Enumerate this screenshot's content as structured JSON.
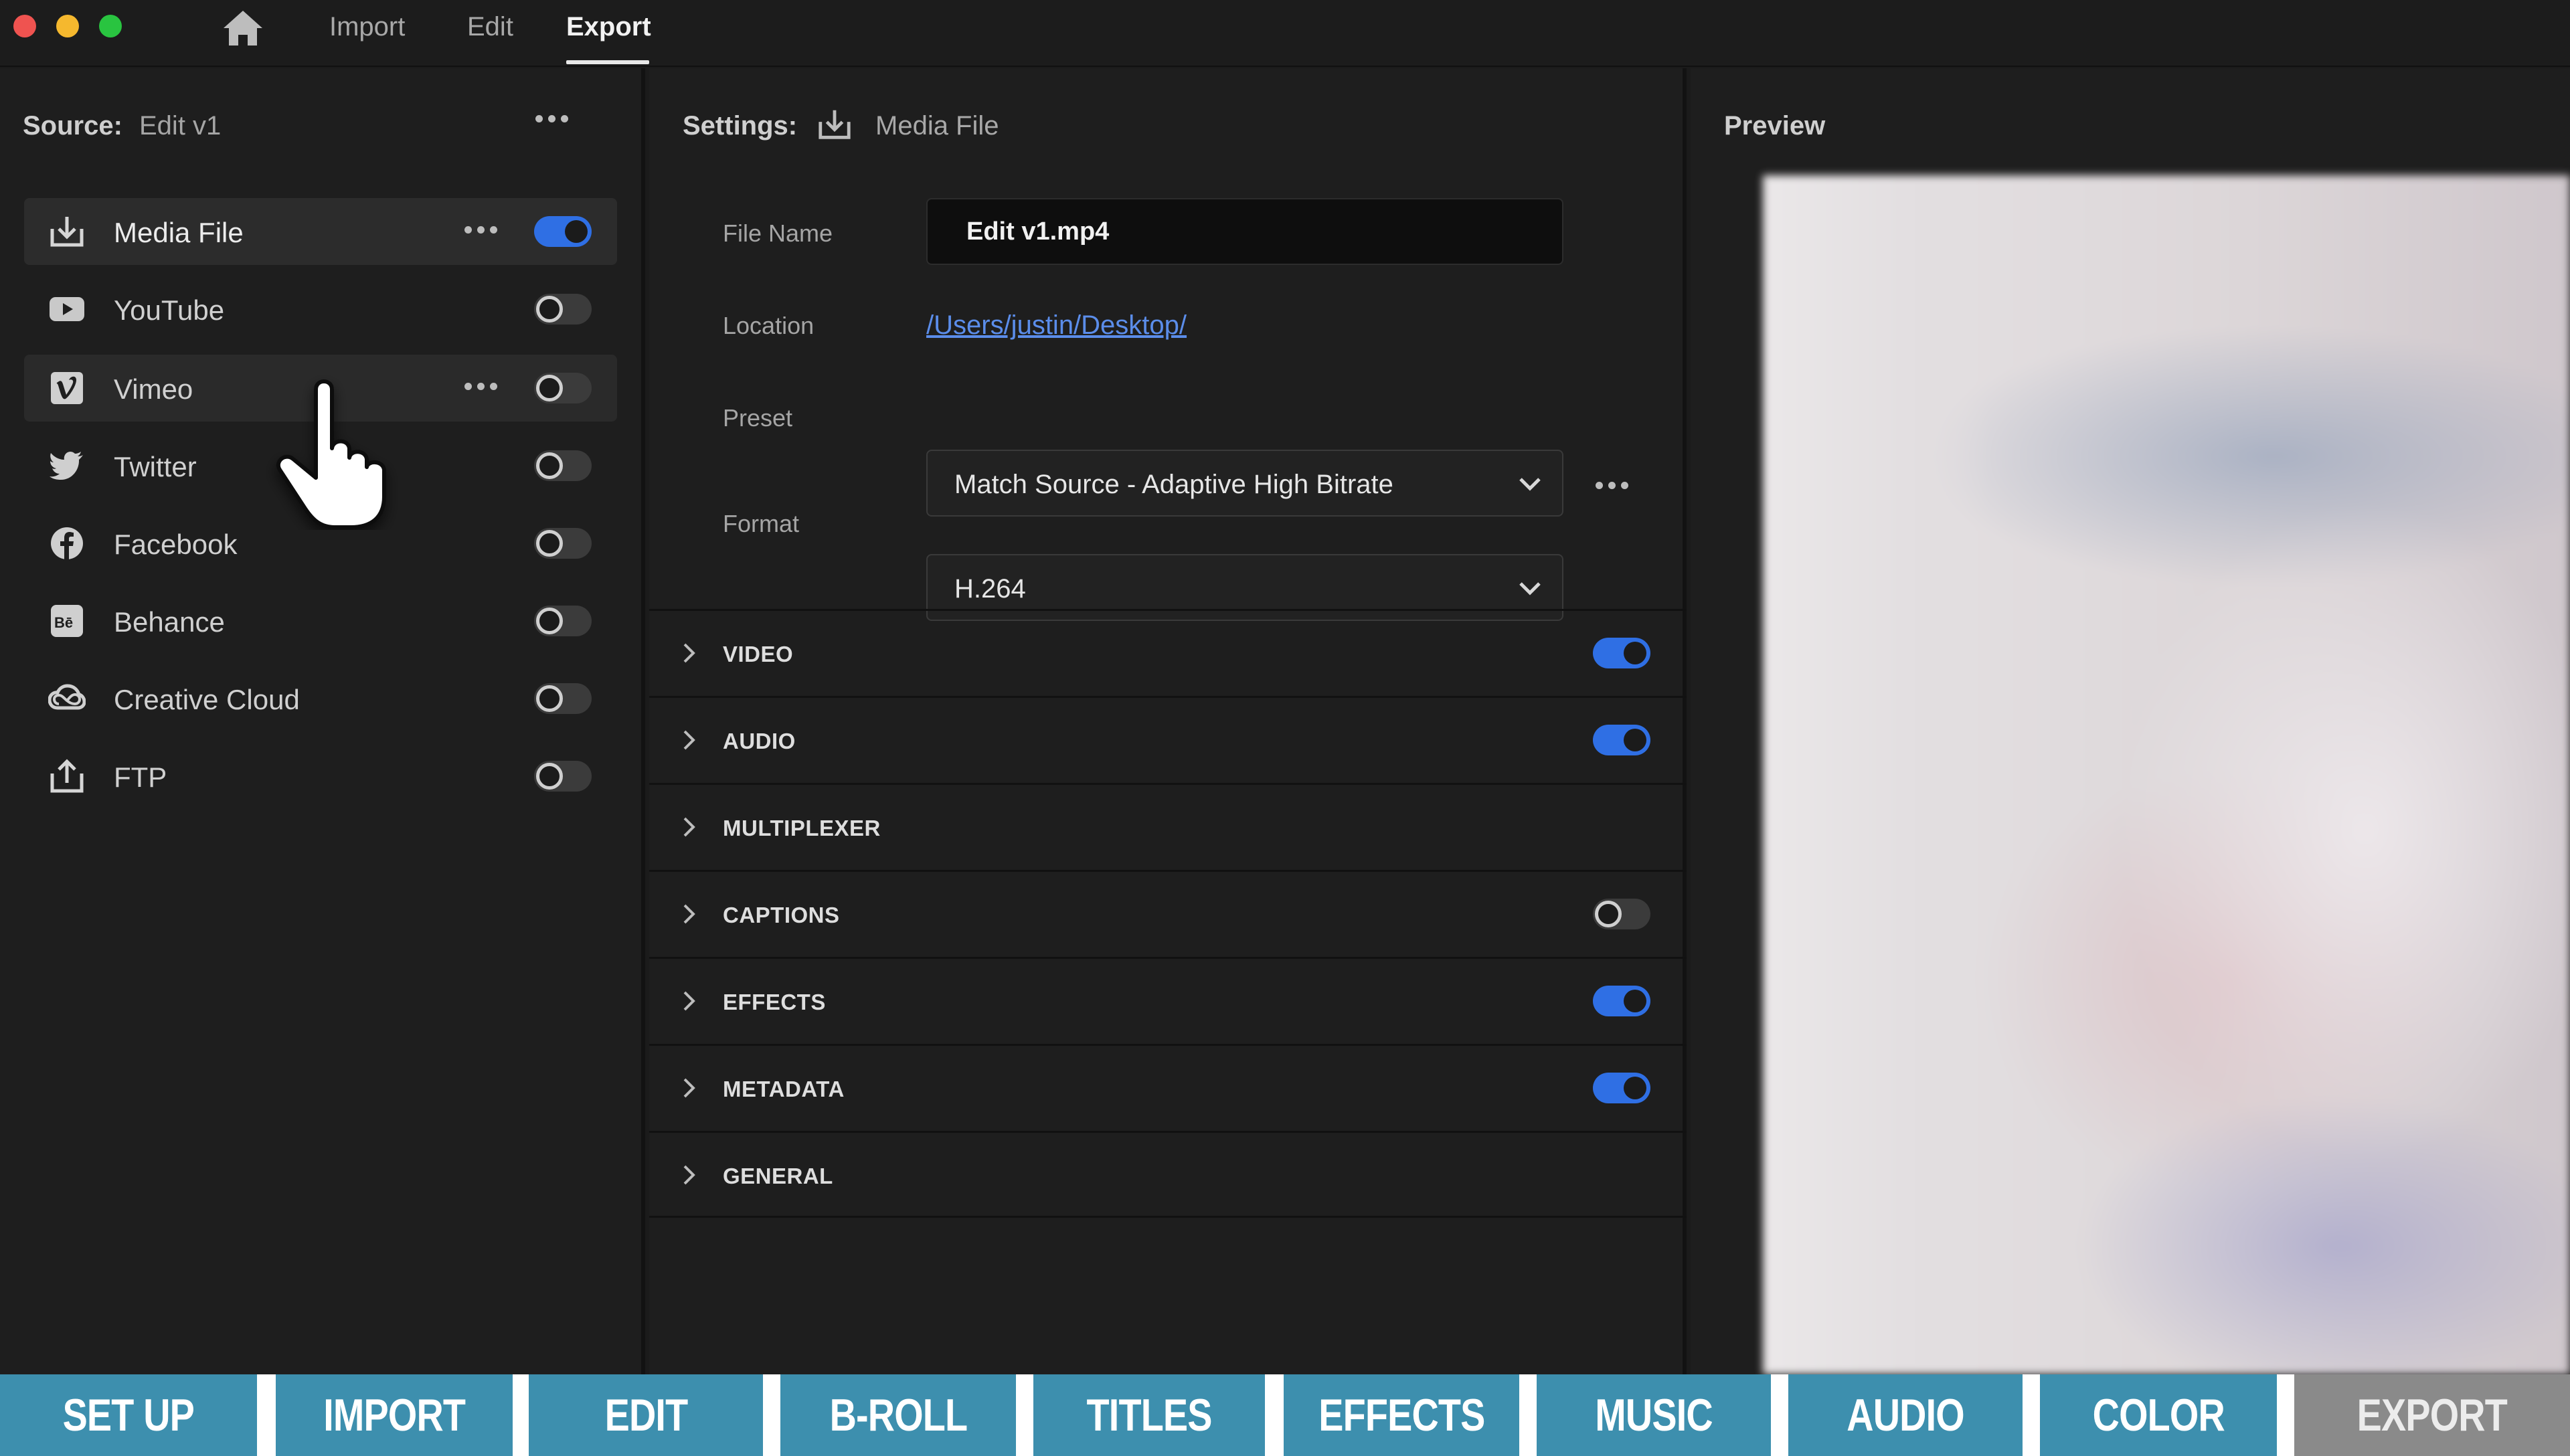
{
  "window": {
    "traffic_lights": {
      "close": "#ef5350",
      "minimize": "#f5b82e",
      "zoom": "#29c440"
    }
  },
  "top_nav": {
    "home_icon": "home-icon",
    "tabs": [
      {
        "label": "Import",
        "active": false
      },
      {
        "label": "Edit",
        "active": false
      },
      {
        "label": "Export",
        "active": true
      }
    ]
  },
  "source": {
    "label": "Source:",
    "value": "Edit v1"
  },
  "destinations": [
    {
      "label": "Media File",
      "icon": "download-icon",
      "enabled": true,
      "selected": true,
      "show_more": true
    },
    {
      "label": "YouTube",
      "icon": "youtube-icon",
      "enabled": false,
      "selected": false,
      "show_more": false
    },
    {
      "label": "Vimeo",
      "icon": "vimeo-icon",
      "enabled": false,
      "selected": false,
      "show_more": true
    },
    {
      "label": "Twitter",
      "icon": "twitter-icon",
      "enabled": false,
      "selected": false,
      "show_more": false
    },
    {
      "label": "Facebook",
      "icon": "facebook-icon",
      "enabled": false,
      "selected": false,
      "show_more": false
    },
    {
      "label": "Behance",
      "icon": "behance-icon",
      "enabled": false,
      "selected": false,
      "show_more": false
    },
    {
      "label": "Creative Cloud",
      "icon": "creative-cloud-icon",
      "enabled": false,
      "selected": false,
      "show_more": false
    },
    {
      "label": "FTP",
      "icon": "upload-icon",
      "enabled": false,
      "selected": false,
      "show_more": false
    }
  ],
  "settings": {
    "label": "Settings:",
    "value": "Media File",
    "fields": {
      "file_name_label": "File Name",
      "file_name_value": "Edit v1.mp4",
      "location_label": "Location",
      "location_value": "/Users/justin/Desktop/",
      "preset_label": "Preset",
      "preset_value": "Match Source - Adaptive High Bitrate",
      "format_label": "Format",
      "format_value": "H.264"
    },
    "sections": [
      {
        "label": "VIDEO",
        "toggle": true,
        "enabled": true
      },
      {
        "label": "AUDIO",
        "toggle": true,
        "enabled": true
      },
      {
        "label": "MULTIPLEXER",
        "toggle": false,
        "enabled": false
      },
      {
        "label": "CAPTIONS",
        "toggle": true,
        "enabled": false
      },
      {
        "label": "EFFECTS",
        "toggle": true,
        "enabled": true
      },
      {
        "label": "METADATA",
        "toggle": true,
        "enabled": true
      },
      {
        "label": "GENERAL",
        "toggle": false,
        "enabled": false
      }
    ]
  },
  "preview": {
    "label": "Preview"
  },
  "workflow_bar": {
    "tabs": [
      {
        "label": "SET UP",
        "active": false
      },
      {
        "label": "IMPORT",
        "active": false
      },
      {
        "label": "EDIT",
        "active": false
      },
      {
        "label": "B-ROLL",
        "active": false
      },
      {
        "label": "TITLES",
        "active": false
      },
      {
        "label": "EFFECTS",
        "active": false
      },
      {
        "label": "MUSIC",
        "active": false
      },
      {
        "label": "AUDIO",
        "active": false
      },
      {
        "label": "COLOR",
        "active": false
      },
      {
        "label": "EXPORT",
        "active": true
      }
    ]
  },
  "colors": {
    "accent_blue": "#2f6fe4",
    "link_blue": "#5b8dea",
    "workflow_teal": "#3d8fae",
    "workflow_active_gray": "#8a8a8a"
  }
}
